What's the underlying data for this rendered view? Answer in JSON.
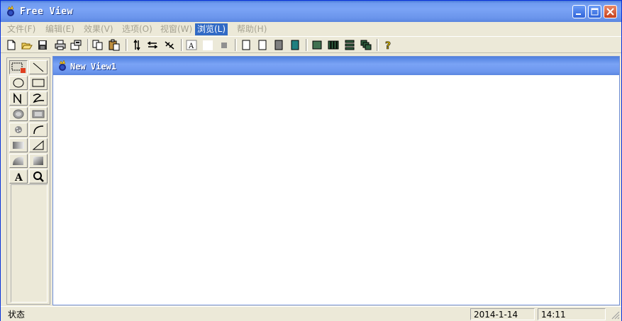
{
  "window": {
    "title": "Free View"
  },
  "menu": [
    {
      "label": "文件(F)"
    },
    {
      "label": "编辑(E)"
    },
    {
      "label": "效果(V)"
    },
    {
      "label": "选项(O)"
    },
    {
      "label": "视窗(W)"
    },
    {
      "label": "浏览(L)",
      "active": true
    },
    {
      "label": "帮助(H)"
    }
  ],
  "toolbar_icons": [
    "new-file",
    "open-folder",
    "save",
    "print",
    "properties",
    "copy",
    "paste",
    "flip-vertical",
    "flip-horizontal",
    "rotate",
    "text-frame",
    "white-swatch",
    "gray-swatch",
    "rect-outline",
    "rect-outline-2",
    "gray-rect",
    "teal-rect",
    "green-rect",
    "vertical-bars",
    "horizontal-bars",
    "cascade-windows",
    "help"
  ],
  "tool_palette": [
    "select-rect",
    "line",
    "ellipse",
    "rectangle",
    "polyline",
    "freehand",
    "ellipse-filled",
    "rect-filled",
    "spray",
    "arc",
    "gradient-rect",
    "right-triangle",
    "gradient-arc",
    "gradient-square",
    "text-tool",
    "zoom"
  ],
  "child_window": {
    "title": "New View1"
  },
  "status": {
    "text": "状态",
    "date": "2014-1-14",
    "time": "14:11"
  },
  "colors": {
    "title_bar": "#7aa3f5",
    "menu_active": "#316ac5",
    "chrome": "#ece9d8"
  }
}
